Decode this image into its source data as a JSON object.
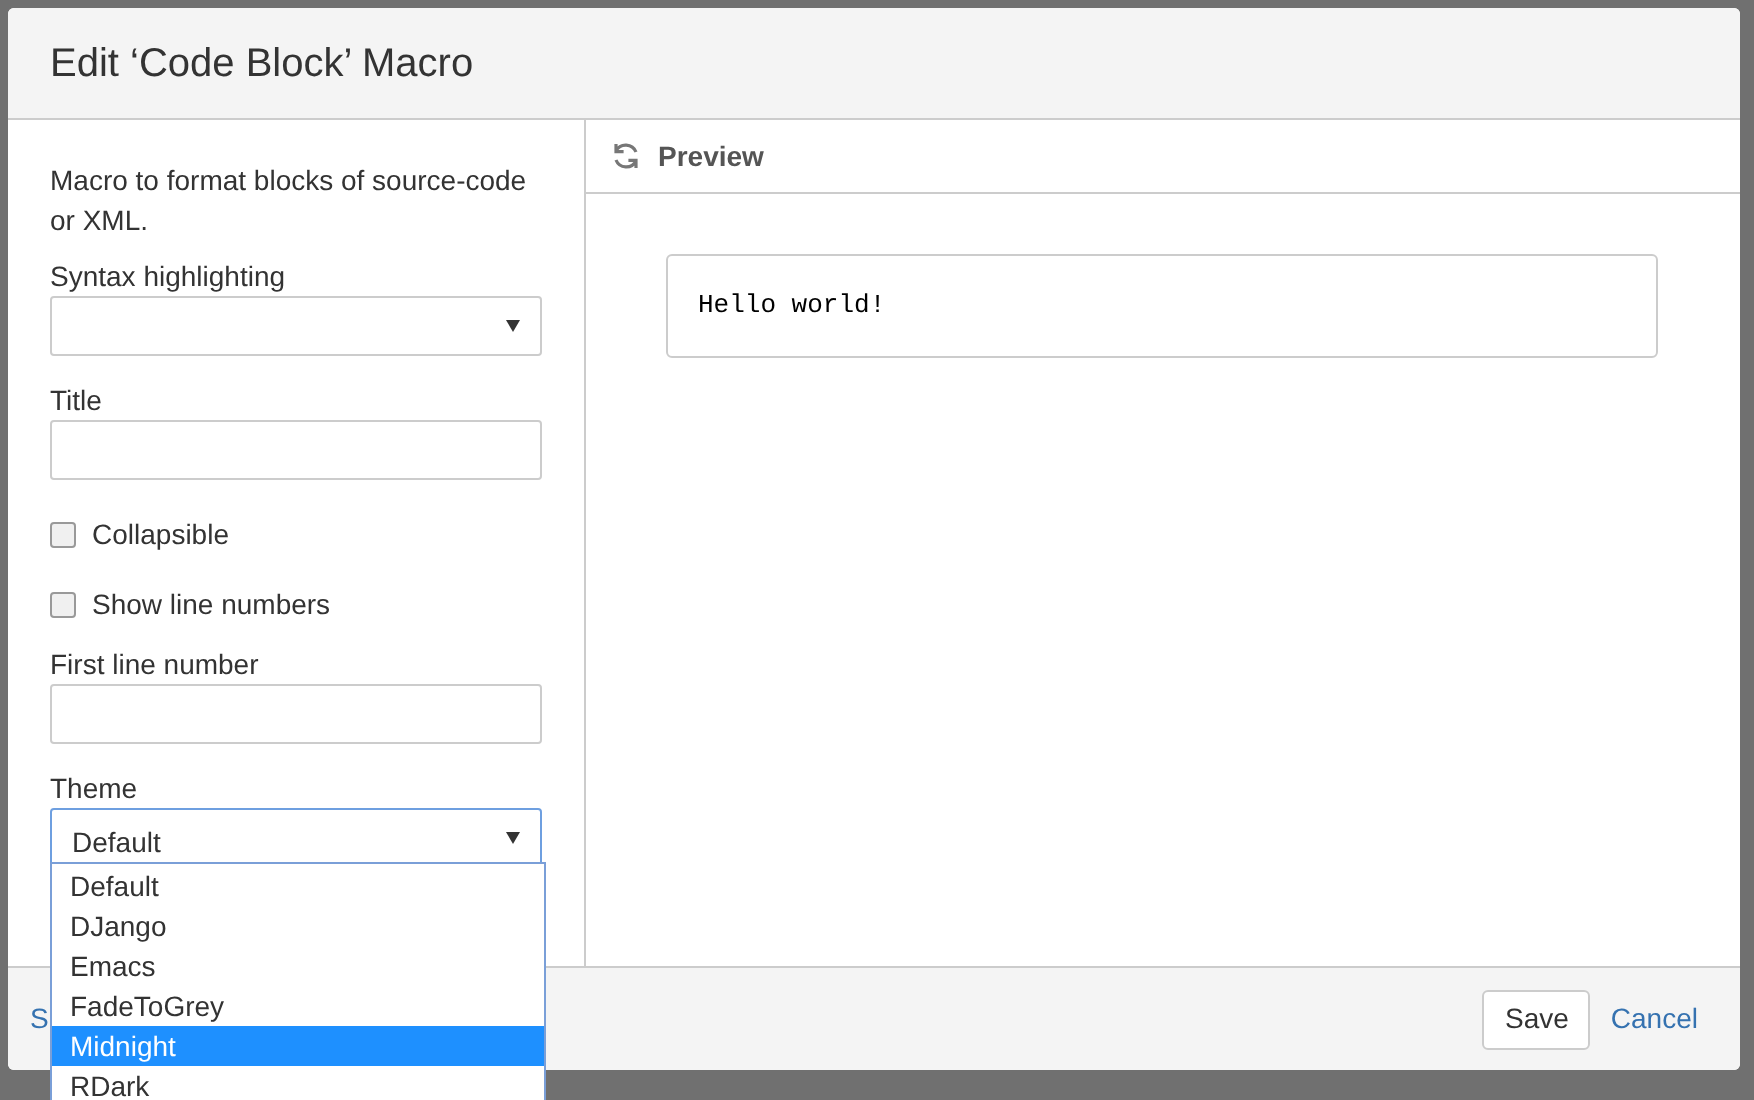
{
  "dialog": {
    "title": "Edit ‘Code Block’ Macro"
  },
  "description": "Macro to format blocks of source-code or XML.",
  "fields": [
    {
      "kind": "select",
      "label": "Syntax highlighting"
    },
    {
      "kind": "text",
      "label": "Title"
    },
    {
      "kind": "checkbox",
      "label": "Collapsible",
      "checked": false
    },
    {
      "kind": "checkbox",
      "label": "Show line numbers",
      "checked": false
    },
    {
      "kind": "text",
      "label": "First line number"
    },
    {
      "kind": "select",
      "label": "Theme",
      "value": "Default",
      "focused": true
    }
  ],
  "theme_options": [
    {
      "label": "Default",
      "selected": false
    },
    {
      "label": "DJango",
      "selected": false
    },
    {
      "label": "Emacs",
      "selected": false
    },
    {
      "label": "FadeToGrey",
      "selected": false
    },
    {
      "label": "Midnight",
      "selected": true
    },
    {
      "label": "RDark",
      "selected": false
    }
  ],
  "preview": {
    "title": "Preview",
    "code": "Hello world!"
  },
  "footer": {
    "link": "S",
    "buttons": [
      {
        "label": "Save",
        "kind": "button"
      },
      {
        "label": "Cancel",
        "kind": "link"
      }
    ]
  }
}
